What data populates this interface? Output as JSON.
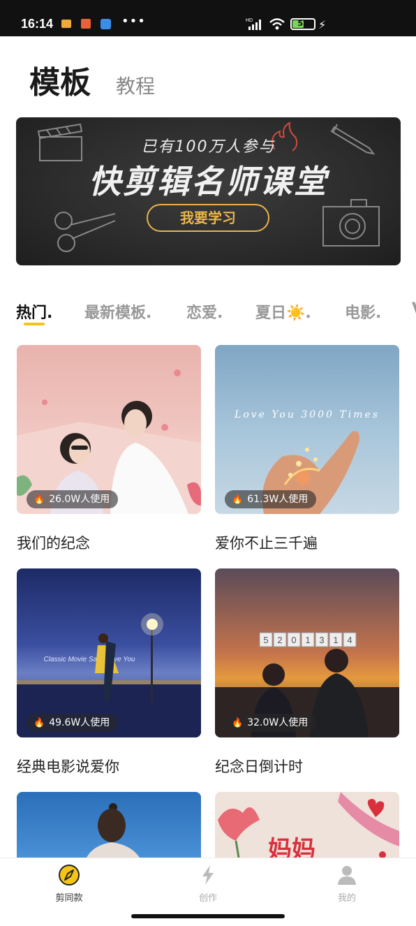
{
  "status_bar": {
    "time": "16:14",
    "network": "HD",
    "battery": "53",
    "battery_level": 0.53,
    "icons": [
      "message-icon",
      "bag-icon",
      "app-icon",
      "more-dots-icon",
      "signal-icon",
      "wifi-icon",
      "battery-icon",
      "charging-icon"
    ]
  },
  "header": {
    "tabs": [
      {
        "label": "模板",
        "active": true
      },
      {
        "label": "教程",
        "active": false
      }
    ]
  },
  "banner": {
    "subtitle": "已有100万人参与",
    "title": "快剪辑名师课堂",
    "button_label": "我要学习"
  },
  "categories": [
    {
      "label": "热门.",
      "active": true
    },
    {
      "label": "最新模板.",
      "active": false
    },
    {
      "label": "恋爱.",
      "active": false
    },
    {
      "label": "夏日☀️.",
      "active": false
    },
    {
      "label": "电影.",
      "active": false
    },
    {
      "label": "V",
      "active": false
    }
  ],
  "templates": [
    {
      "title": "我们的纪念",
      "usage": "26.0W人使用"
    },
    {
      "title": "爱你不止三千遍",
      "usage": "61.3W人使用",
      "overlay_text": "Love You 3000 Times"
    },
    {
      "title": "经典电影说爱你",
      "usage": "49.6W人使用",
      "overlay_text": "Classic Movie Says Love You"
    },
    {
      "title": "纪念日倒计时",
      "usage": "32.0W人使用",
      "overlay_digits": [
        "5",
        "2",
        "0",
        "1",
        "3",
        "1",
        "4"
      ]
    },
    {
      "title": "",
      "usage": ""
    },
    {
      "title": "",
      "usage": "",
      "overlay_text": "妈妈"
    }
  ],
  "bottom_nav": [
    {
      "label": "剪同款",
      "icon": "compass-icon",
      "active": true
    },
    {
      "label": "创作",
      "icon": "lightning-icon",
      "active": false
    },
    {
      "label": "我的",
      "icon": "user-icon",
      "active": false
    }
  ],
  "colors": {
    "accent": "#f6c417",
    "banner_button": "#e8b64a"
  }
}
